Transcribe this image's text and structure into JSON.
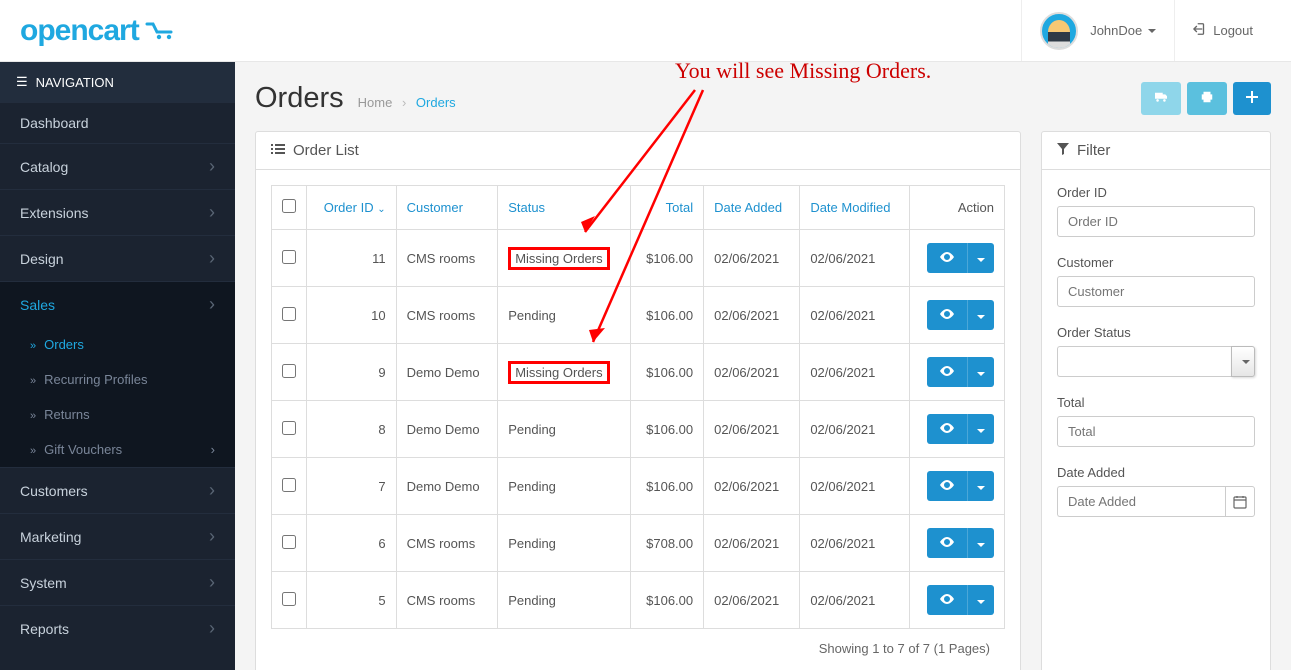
{
  "header": {
    "logo_text": "opencart",
    "username": "JohnDoe",
    "logout": "Logout"
  },
  "sidebar": {
    "title": "NAVIGATION",
    "items": [
      {
        "label": "Dashboard",
        "chev": false
      },
      {
        "label": "Catalog",
        "chev": true
      },
      {
        "label": "Extensions",
        "chev": true
      },
      {
        "label": "Design",
        "chev": true
      },
      {
        "label": "Sales",
        "chev": true,
        "active": true
      },
      {
        "label": "Customers",
        "chev": true
      },
      {
        "label": "Marketing",
        "chev": true
      },
      {
        "label": "System",
        "chev": true
      },
      {
        "label": "Reports",
        "chev": true
      }
    ],
    "sales_sub": [
      {
        "label": "Orders",
        "sel": true
      },
      {
        "label": "Recurring Profiles"
      },
      {
        "label": "Returns"
      },
      {
        "label": "Gift Vouchers",
        "chev": true
      }
    ]
  },
  "page": {
    "title": "Orders",
    "bc_home": "Home",
    "bc_current": "Orders"
  },
  "annotation": "You will see Missing Orders.",
  "orderlist": {
    "heading": "Order List",
    "cols": {
      "order_id": "Order ID",
      "customer": "Customer",
      "status": "Status",
      "total": "Total",
      "date_added": "Date Added",
      "date_modified": "Date Modified",
      "action": "Action"
    },
    "rows": [
      {
        "id": "11",
        "customer": "CMS rooms",
        "status": "Missing Orders",
        "hl": true,
        "total": "$106.00",
        "added": "02/06/2021",
        "modified": "02/06/2021"
      },
      {
        "id": "10",
        "customer": "CMS rooms",
        "status": "Pending",
        "total": "$106.00",
        "added": "02/06/2021",
        "modified": "02/06/2021"
      },
      {
        "id": "9",
        "customer": "Demo Demo",
        "status": "Missing Orders",
        "hl": true,
        "total": "$106.00",
        "added": "02/06/2021",
        "modified": "02/06/2021"
      },
      {
        "id": "8",
        "customer": "Demo Demo",
        "status": "Pending",
        "total": "$106.00",
        "added": "02/06/2021",
        "modified": "02/06/2021"
      },
      {
        "id": "7",
        "customer": "Demo Demo",
        "status": "Pending",
        "total": "$106.00",
        "added": "02/06/2021",
        "modified": "02/06/2021"
      },
      {
        "id": "6",
        "customer": "CMS rooms",
        "status": "Pending",
        "total": "$708.00",
        "added": "02/06/2021",
        "modified": "02/06/2021"
      },
      {
        "id": "5",
        "customer": "CMS rooms",
        "status": "Pending",
        "total": "$106.00",
        "added": "02/06/2021",
        "modified": "02/06/2021"
      }
    ],
    "footer": "Showing 1 to 7 of 7 (1 Pages)"
  },
  "filter": {
    "heading": "Filter",
    "order_id_label": "Order ID",
    "order_id_ph": "Order ID",
    "customer_label": "Customer",
    "customer_ph": "Customer",
    "status_label": "Order Status",
    "total_label": "Total",
    "total_ph": "Total",
    "date_added_label": "Date Added",
    "date_added_ph": "Date Added"
  }
}
